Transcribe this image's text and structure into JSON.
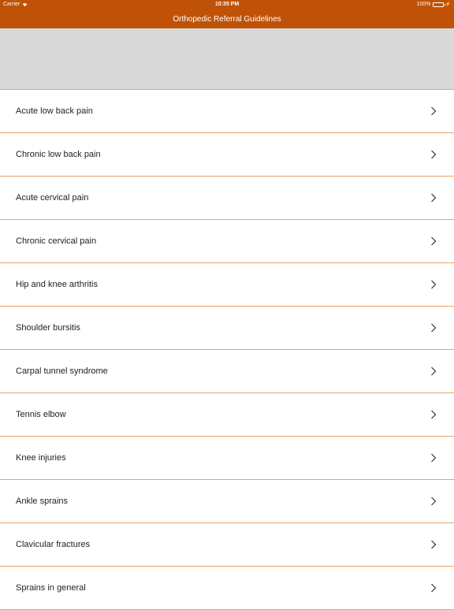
{
  "status_bar": {
    "carrier": "Carrier",
    "time": "10:35 PM",
    "battery": "100%"
  },
  "nav": {
    "title": "Orthopedic Referral Guidelines"
  },
  "colors": {
    "brand": "#bf5206",
    "separator": "#e8a36b",
    "banner": "#d9d9d9"
  },
  "list": {
    "items": [
      {
        "label": "Acute low back pain"
      },
      {
        "label": "Chronic low back pain"
      },
      {
        "label": "Acute cervical pain"
      },
      {
        "label": "Chronic cervical pain"
      },
      {
        "label": "Hip and knee arthritis"
      },
      {
        "label": "Shoulder bursitis"
      },
      {
        "label": "Carpal tunnel syndrome"
      },
      {
        "label": "Tennis elbow"
      },
      {
        "label": "Knee injuries"
      },
      {
        "label": "Ankle sprains"
      },
      {
        "label": "Clavicular fractures"
      },
      {
        "label": "Sprains in general"
      }
    ]
  }
}
